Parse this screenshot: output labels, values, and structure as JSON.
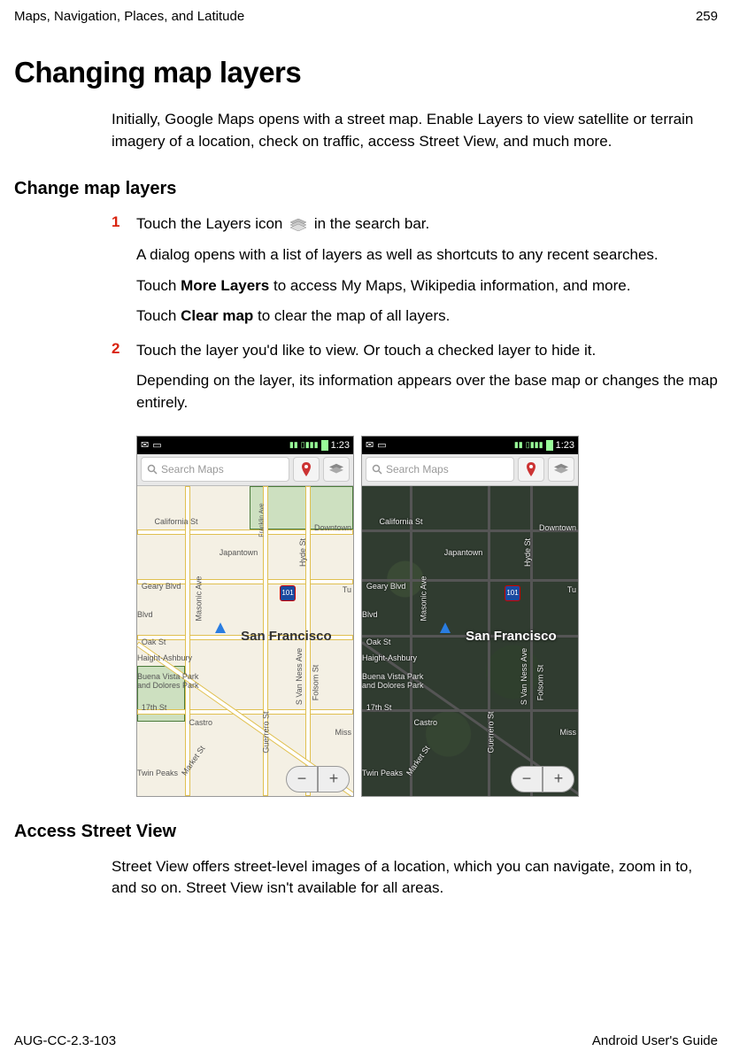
{
  "header": {
    "chapter": "Maps, Navigation, Places, and Latitude",
    "page_number": "259"
  },
  "title": "Changing map layers",
  "intro": "Initially, Google Maps opens with a street map. Enable Layers to view satellite or terrain imagery of a location, check on traffic, access Street View, and much more.",
  "section1": {
    "heading": "Change map layers",
    "step1": {
      "num": "1",
      "line1_a": "Touch the Layers icon ",
      "line1_b": " in the search bar.",
      "line2": "A dialog opens with a list of layers as well as shortcuts to any recent searches.",
      "line3_a": "Touch ",
      "line3_bold": "More Layers",
      "line3_b": " to access My Maps, Wikipedia information, and more.",
      "line4_a": "Touch ",
      "line4_bold": "Clear map",
      "line4_b": " to clear the map of all layers."
    },
    "step2": {
      "num": "2",
      "line1": "Touch the layer you'd like to view. Or touch a checked layer to hide it.",
      "line2": "Depending on the layer, its information appears over the base map or changes the map entirely."
    }
  },
  "screenshots": {
    "status_time": "1:23",
    "search_placeholder": "Search Maps",
    "city": "San Francisco",
    "highway": "101",
    "labels": {
      "california": "California St",
      "japantown": "Japantown",
      "downtown": "Downtown",
      "geary": "Geary Blvd",
      "blvd": "Blvd",
      "masonic": "Masonic Ave",
      "oak": "Oak St",
      "haight": "Haight-Ashbury",
      "buena": "Buena Vista Park and Dolores Park",
      "seventeenth": "17th St",
      "castro": "Castro",
      "twinpeaks": "Twin Peaks",
      "market": "Market St",
      "vanness": "S Van Ness Ave",
      "folsom": "Folsom St",
      "guerrero": "Guerrero St",
      "miss": "Miss",
      "hyde": "Hyde St",
      "franklin": "Franklin Ave",
      "tu": "Tu"
    }
  },
  "section2": {
    "heading": "Access Street View",
    "para": "Street View offers street-level images of a location, which you can navigate, zoom in to, and so on. Street View isn't available for all areas."
  },
  "footer": {
    "doc_id": "AUG-CC-2.3-103",
    "guide": "Android User's Guide"
  }
}
